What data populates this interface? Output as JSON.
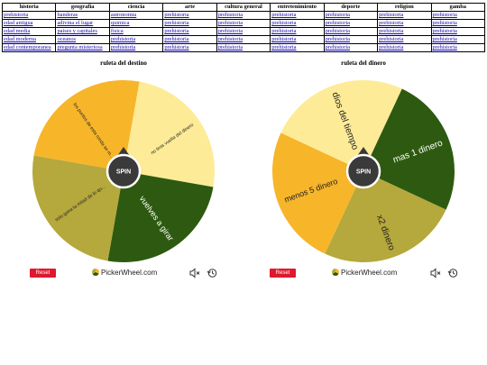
{
  "table": {
    "headers": [
      "historia",
      "geografia",
      "ciencia",
      "arte",
      "cultura general",
      "entretenimiento",
      "deporte",
      "religion",
      "gamba"
    ],
    "rows": [
      [
        "prehistoria",
        "banderas",
        "astronomia",
        "prehistoria",
        "prehistoria",
        "prehistoria",
        "prehistoria",
        "prehistoria",
        "prehistoria"
      ],
      [
        "edad antigua",
        "adivina el lugar",
        "quimica",
        "prehistoria",
        "prehistoria",
        "prehistoria",
        "prehistoria",
        "prehistoria",
        "prehistoria"
      ],
      [
        "edad media",
        "paises y capitales",
        "fisica",
        "prehistoria",
        "prehistoria",
        "prehistoria",
        "prehistoria",
        "prehistoria",
        "prehistoria"
      ],
      [
        "edad moderna",
        "oceanos",
        "prehistoria",
        "prehistoria",
        "prehistoria",
        "prehistoria",
        "prehistoria",
        "prehistoria",
        "prehistoria"
      ],
      [
        "edad contemporanea",
        "pregunta misteriosa",
        "prehistoria",
        "prehistoria",
        "prehistoria",
        "prehistoria",
        "prehistoria",
        "prehistoria",
        "prehistoria"
      ]
    ]
  },
  "wheels": [
    {
      "title": "ruleta del destino",
      "spin_label": "SPIN",
      "reset_label": "Reset",
      "brand": "PickerWheel.com",
      "segments": [
        {
          "label": "no tiras vuelta del dinero",
          "color": "#fdeb97"
        },
        {
          "label": "vuelves a girar",
          "color": "#2d5a10"
        },
        {
          "label": "solo gana la mitad de lo qu...",
          "color": "#b5a83c"
        },
        {
          "label": "los puntos de esta ronda se m...",
          "color": "#f7b52a"
        }
      ]
    },
    {
      "title": "ruleta del dinero",
      "spin_label": "SPIN",
      "reset_label": "Reset",
      "brand": "PickerWheel.com",
      "segments": [
        {
          "label": "mas 1 dinero",
          "color": "#2d5a10"
        },
        {
          "label": "x2 dinero",
          "color": "#b5a83c"
        },
        {
          "label": "menos 5 dinero",
          "color": "#f7b52a"
        },
        {
          "label": "dios del tiempo",
          "color": "#fdeb97"
        }
      ]
    }
  ],
  "icons": {
    "mute": "speaker-mute-icon",
    "history": "history-icon"
  }
}
